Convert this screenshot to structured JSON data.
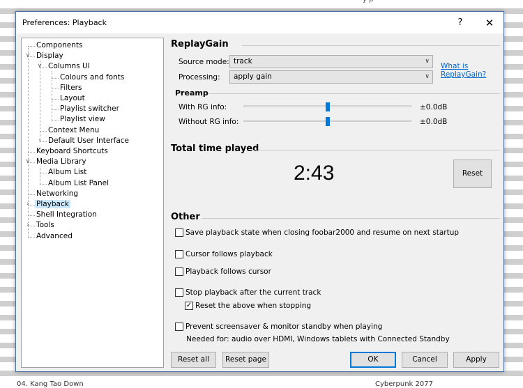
{
  "background": {
    "top_text": "y p",
    "bottom_left_text": "04. Kang Tao Down",
    "bottom_right_text": "Cyberpunk 2077"
  },
  "window": {
    "title": "Preferences: Playback",
    "help_label": "?",
    "close_label": "✕"
  },
  "tree": {
    "items": [
      {
        "label": "Components",
        "level": 0,
        "expander": ""
      },
      {
        "label": "Display",
        "level": 0,
        "expander": "expanded"
      },
      {
        "label": "Columns UI",
        "level": 1,
        "expander": "expanded"
      },
      {
        "label": "Colours and fonts",
        "level": 2,
        "expander": ""
      },
      {
        "label": "Filters",
        "level": 2,
        "expander": ""
      },
      {
        "label": "Layout",
        "level": 2,
        "expander": ""
      },
      {
        "label": "Playlist switcher",
        "level": 2,
        "expander": ""
      },
      {
        "label": "Playlist view",
        "level": 2,
        "expander": ""
      },
      {
        "label": "Context Menu",
        "level": 1,
        "expander": ""
      },
      {
        "label": "Default User Interface",
        "level": 1,
        "expander": "collapsed"
      },
      {
        "label": "Keyboard Shortcuts",
        "level": 0,
        "expander": ""
      },
      {
        "label": "Media Library",
        "level": 0,
        "expander": "expanded"
      },
      {
        "label": "Album List",
        "level": 1,
        "expander": ""
      },
      {
        "label": "Album List Panel",
        "level": 1,
        "expander": ""
      },
      {
        "label": "Networking",
        "level": 0,
        "expander": ""
      },
      {
        "label": "Playback",
        "level": 0,
        "expander": "collapsed",
        "selected": true
      },
      {
        "label": "Shell Integration",
        "level": 0,
        "expander": ""
      },
      {
        "label": "Tools",
        "level": 0,
        "expander": "collapsed"
      },
      {
        "label": "Advanced",
        "level": 0,
        "expander": ""
      }
    ]
  },
  "replaygain": {
    "title": "ReplayGain",
    "source_mode_label": "Source mode:",
    "source_mode_value": "track",
    "processing_label": "Processing:",
    "processing_value": "apply gain",
    "help_link": "What is ReplayGain?",
    "help_link_line1": "What is",
    "help_link_line2": "ReplayGain?"
  },
  "preamp": {
    "title": "Preamp",
    "with_rg_label": "With RG info:",
    "with_rg_value": "±0.0dB",
    "with_rg_position": 0.5,
    "without_rg_label": "Without RG info:",
    "without_rg_value": "±0.0dB",
    "without_rg_position": 0.5
  },
  "total_time": {
    "title": "Total time played",
    "value": "2:43",
    "reset_label": "Reset"
  },
  "other": {
    "title": "Other",
    "save_state": {
      "label": "Save playback state when closing foobar2000 and resume on next startup",
      "checked": false
    },
    "cursor_follows": {
      "label": "Cursor follows playback",
      "checked": false
    },
    "playback_follows": {
      "label": "Playback follows cursor",
      "checked": false
    },
    "stop_after_current": {
      "label": "Stop playback after the current track",
      "checked": false
    },
    "reset_above": {
      "label": "Reset the above when stopping",
      "checked": true
    },
    "prevent_screensaver": {
      "label": "Prevent screensaver & monitor standby when playing",
      "checked": false
    },
    "prevent_note": "Needed for: audio over HDMI, Windows tablets with Connected Standby"
  },
  "buttons": {
    "reset_all": "Reset all",
    "reset_page": "Reset page",
    "ok": "OK",
    "cancel": "Cancel",
    "apply": "Apply"
  },
  "check_glyph": "✓"
}
